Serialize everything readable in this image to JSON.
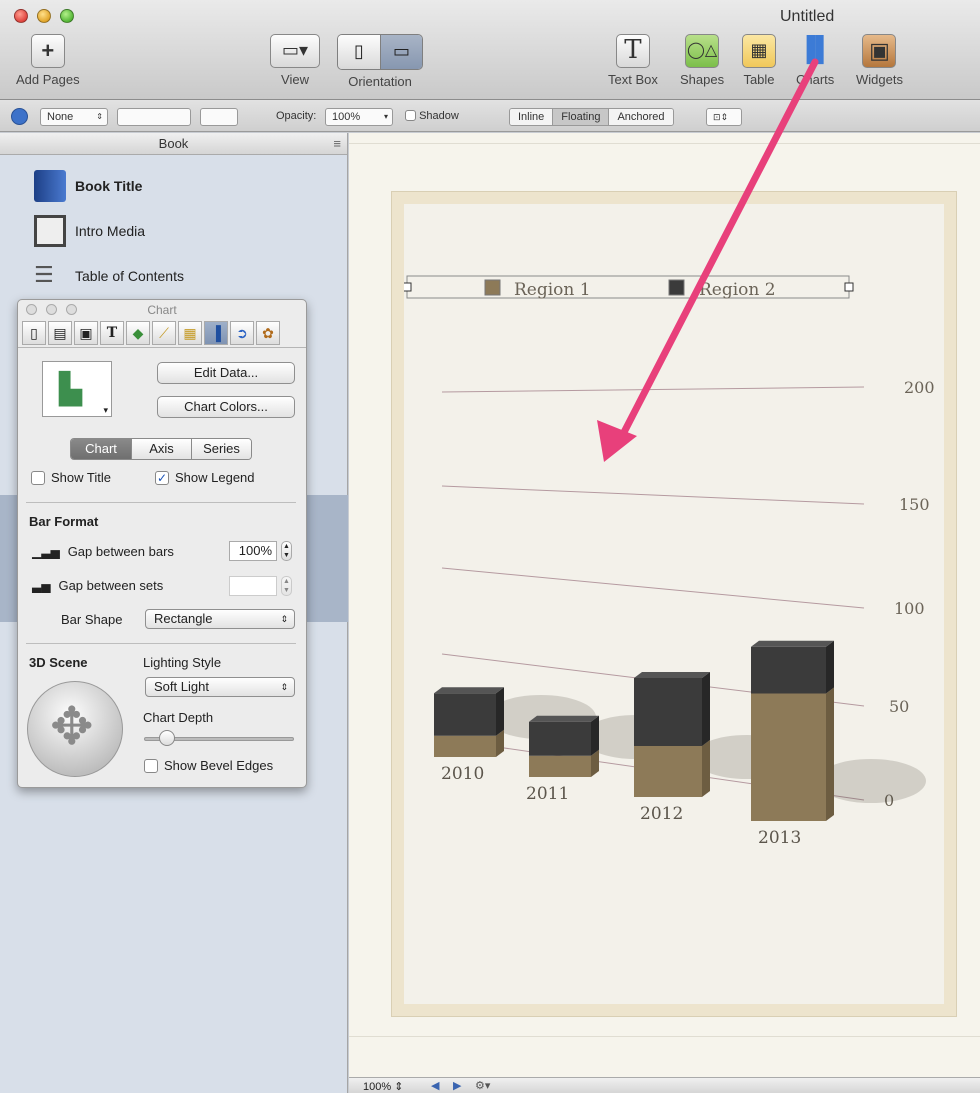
{
  "window": {
    "title": "Untitled"
  },
  "toolbar": {
    "add_pages": "Add Pages",
    "view": "View",
    "orientation": "Orientation",
    "text_box": "Text Box",
    "shapes": "Shapes",
    "table": "Table",
    "charts": "Charts",
    "widgets": "Widgets"
  },
  "formatbar": {
    "style_value": "None",
    "opacity_label": "Opacity:",
    "opacity_value": "100%",
    "shadow_label": "Shadow",
    "wrap_options": [
      "Inline",
      "Floating",
      "Anchored"
    ],
    "wrap_selected": "Floating"
  },
  "sidebar": {
    "header": "Book",
    "items": [
      {
        "label": "Book Title",
        "bold": true
      },
      {
        "label": "Intro Media",
        "bold": false
      },
      {
        "label": "Table of Contents",
        "bold": false
      }
    ]
  },
  "inspector": {
    "title": "Chart",
    "edit_data": "Edit Data...",
    "chart_colors": "Chart Colors...",
    "tabs": [
      "Chart",
      "Axis",
      "Series"
    ],
    "active_tab": "Chart",
    "show_title": {
      "label": "Show Title",
      "checked": false
    },
    "show_legend": {
      "label": "Show Legend",
      "checked": true
    },
    "bar_format": "Bar Format",
    "gap_between_bars_label": "Gap between bars",
    "gap_between_bars_value": "100%",
    "gap_between_sets_label": "Gap between sets",
    "gap_between_sets_value": "",
    "bar_shape_label": "Bar Shape",
    "bar_shape_value": "Rectangle",
    "scene_3d": "3D Scene",
    "lighting_style_label": "Lighting Style",
    "lighting_style_value": "Soft Light",
    "chart_depth_label": "Chart Depth",
    "chart_depth_value": 0.1,
    "show_bevel_edges": {
      "label": "Show Bevel Edges",
      "checked": false
    }
  },
  "statusbar": {
    "zoom": "100%"
  },
  "colors": {
    "region1": "#8d7a58",
    "region2": "#3b3b3b",
    "arrow": "#e8407b"
  },
  "chart_data": {
    "type": "bar",
    "title": "",
    "categories": [
      "2010",
      "2011",
      "2012",
      "2013"
    ],
    "series": [
      {
        "name": "Region 1",
        "values": [
          25,
          25,
          60,
          150
        ]
      },
      {
        "name": "Region 2",
        "values": [
          50,
          40,
          80,
          55
        ]
      }
    ],
    "stacked": true,
    "three_d": true,
    "ylim": [
      0,
      200
    ],
    "yticks": [
      0,
      50,
      100,
      150,
      200
    ],
    "legend": "top",
    "grid": true
  }
}
